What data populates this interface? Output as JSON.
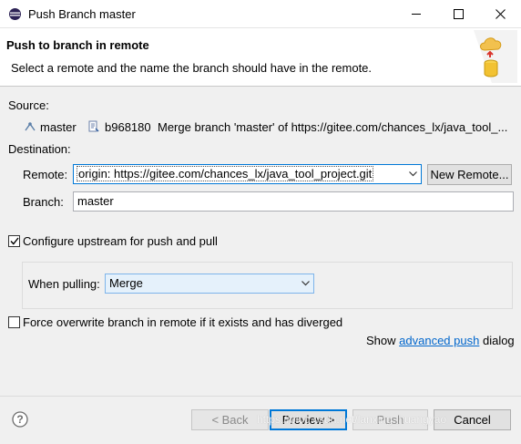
{
  "window": {
    "title": "Push Branch master"
  },
  "banner": {
    "title": "Push to branch in remote",
    "message": "Select a remote and the name the branch should have in the remote."
  },
  "source": {
    "label": "Source:",
    "branch": "master",
    "commit_id": "b968180",
    "commit_message": "Merge branch 'master' of https://gitee.com/chances_lx/java_tool_..."
  },
  "destination": {
    "label": "Destination:",
    "remote_label": "Remote:",
    "remote_value": "origin: https://gitee.com/chances_lx/java_tool_project.git",
    "new_remote_label": "New Remote...",
    "branch_label": "Branch:",
    "branch_value": "master"
  },
  "options": {
    "configure_upstream_label": "Configure upstream for push and pull",
    "configure_upstream_checked": true,
    "when_pulling_label": "When pulling:",
    "when_pulling_value": "Merge",
    "force_overwrite_label": "Force overwrite branch in remote if it exists and has diverged",
    "force_overwrite_checked": false,
    "show_label": "Show",
    "advanced_push_link": "advanced push",
    "dialog_label": "dialog"
  },
  "buttons": {
    "back": "< Back",
    "preview": "Preview >",
    "push": "Push",
    "cancel": "Cancel"
  },
  "watermark": "https://blog.csdn.net/lanxing_huangyao",
  "colors": {
    "accent": "#0078d7",
    "link": "#0066cc",
    "selection": "#cce8ff"
  }
}
